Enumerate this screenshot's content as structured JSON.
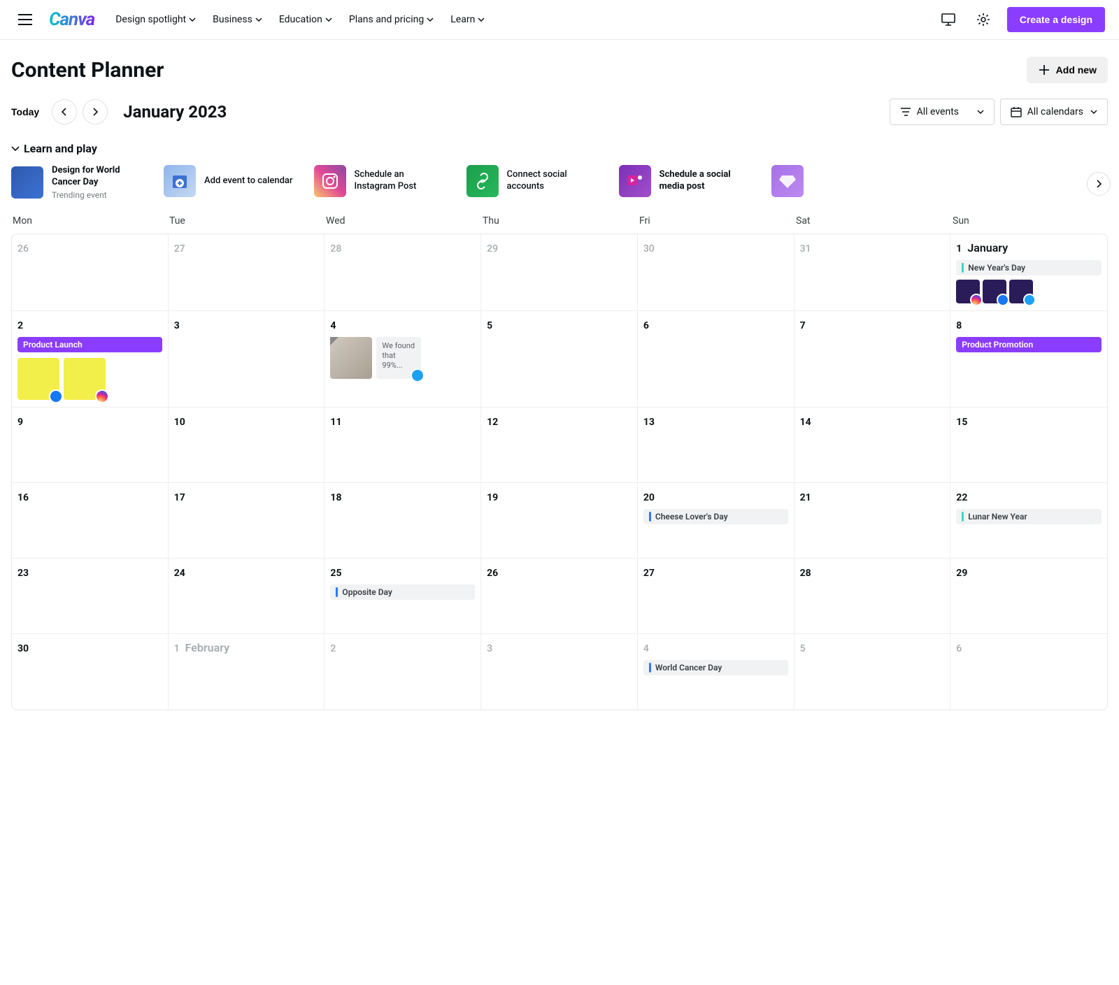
{
  "topnav": {
    "items": [
      "Design spotlight",
      "Business",
      "Education",
      "Plans and pricing",
      "Learn"
    ],
    "create": "Create a design"
  },
  "header": {
    "title": "Content Planner",
    "add_new": "Add new"
  },
  "toolbar": {
    "today": "Today",
    "month": "January 2023",
    "events_filter": "All events",
    "calendars_filter": "All calendars"
  },
  "learn": {
    "title": "Learn and play",
    "cards": [
      {
        "title": "Design for World Cancer Day",
        "subtitle": "Trending event"
      },
      {
        "title": "Add event to calendar"
      },
      {
        "title": "Schedule an Instagram Post"
      },
      {
        "title": "Connect social accounts"
      },
      {
        "title": "Schedule a social media post"
      }
    ]
  },
  "weekdays": [
    "Mon",
    "Tue",
    "Wed",
    "Thu",
    "Fri",
    "Sat",
    "Sun"
  ],
  "calendar": {
    "rows": [
      [
        {
          "n": "26",
          "muted": true
        },
        {
          "n": "27",
          "muted": true
        },
        {
          "n": "28",
          "muted": true
        },
        {
          "n": "29",
          "muted": true
        },
        {
          "n": "30",
          "muted": true
        },
        {
          "n": "31",
          "muted": true
        },
        {
          "n": "1",
          "monthLabel": "January",
          "events": [
            {
              "type": "gray",
              "bar": "teal",
              "label": "New Year's Day"
            }
          ],
          "thumbs3": true
        }
      ],
      [
        {
          "n": "2",
          "events": [
            {
              "type": "purple",
              "label": "Product Launch"
            }
          ],
          "posts2": true
        },
        {
          "n": "3"
        },
        {
          "n": "4",
          "twcard": "We found that 99%..."
        },
        {
          "n": "5"
        },
        {
          "n": "6"
        },
        {
          "n": "7"
        },
        {
          "n": "8",
          "events": [
            {
              "type": "purple",
              "label": "Product Promotion"
            }
          ]
        }
      ],
      [
        {
          "n": "9"
        },
        {
          "n": "10"
        },
        {
          "n": "11"
        },
        {
          "n": "12"
        },
        {
          "n": "13"
        },
        {
          "n": "14"
        },
        {
          "n": "15"
        }
      ],
      [
        {
          "n": "16"
        },
        {
          "n": "17"
        },
        {
          "n": "18"
        },
        {
          "n": "19"
        },
        {
          "n": "20",
          "events": [
            {
              "type": "gray",
              "bar": "blue",
              "label": "Cheese Lover's Day"
            }
          ]
        },
        {
          "n": "21"
        },
        {
          "n": "22",
          "events": [
            {
              "type": "gray",
              "bar": "teal",
              "label": "Lunar New Year"
            }
          ]
        }
      ],
      [
        {
          "n": "23"
        },
        {
          "n": "24"
        },
        {
          "n": "25",
          "events": [
            {
              "type": "gray",
              "bar": "blue",
              "label": "Opposite Day"
            }
          ]
        },
        {
          "n": "26"
        },
        {
          "n": "27"
        },
        {
          "n": "28"
        },
        {
          "n": "29"
        }
      ],
      [
        {
          "n": "30"
        },
        {
          "n": "1",
          "muted": true,
          "monthLabel": "February"
        },
        {
          "n": "2",
          "muted": true
        },
        {
          "n": "3",
          "muted": true
        },
        {
          "n": "4",
          "muted": true,
          "events": [
            {
              "type": "gray",
              "bar": "blue",
              "label": "World Cancer Day"
            }
          ]
        },
        {
          "n": "5",
          "muted": true
        },
        {
          "n": "6",
          "muted": true
        }
      ]
    ]
  }
}
